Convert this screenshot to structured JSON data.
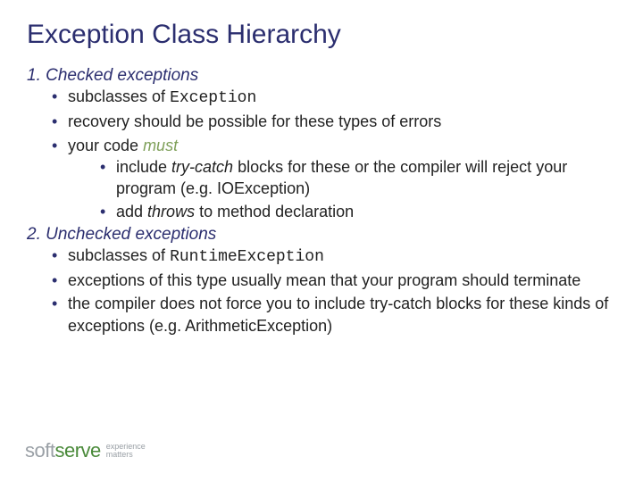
{
  "title": "Exception Class Hierarchy",
  "sections": [
    {
      "heading": "Checked exceptions",
      "bullets": [
        {
          "pre": "subclasses of ",
          "mono": "Exception",
          "post": ""
        },
        {
          "text": "recovery should be possible for these types of errors"
        },
        {
          "pre": "your code ",
          "accent": "must",
          "sub": [
            {
              "pre": "include ",
              "em": "try-catch",
              "post": " blocks for these or the compiler will reject your program (e.g. IOException)"
            },
            {
              "pre": "add ",
              "em": "throws",
              "post": " to method declaration"
            }
          ]
        }
      ]
    },
    {
      "heading": "Unchecked exceptions",
      "bullets": [
        {
          "pre": "subclasses of ",
          "mono": "RuntimeException",
          "post": ""
        },
        {
          "text": "exceptions of this type usually mean that your program should terminate"
        },
        {
          "text": "the compiler does not force you to include try-catch blocks for these kinds of exceptions (e.g. ArithmeticException)"
        }
      ]
    }
  ],
  "logo": {
    "soft": "soft",
    "serve": "serve",
    "tag1": "experience",
    "tag2": "matters"
  }
}
